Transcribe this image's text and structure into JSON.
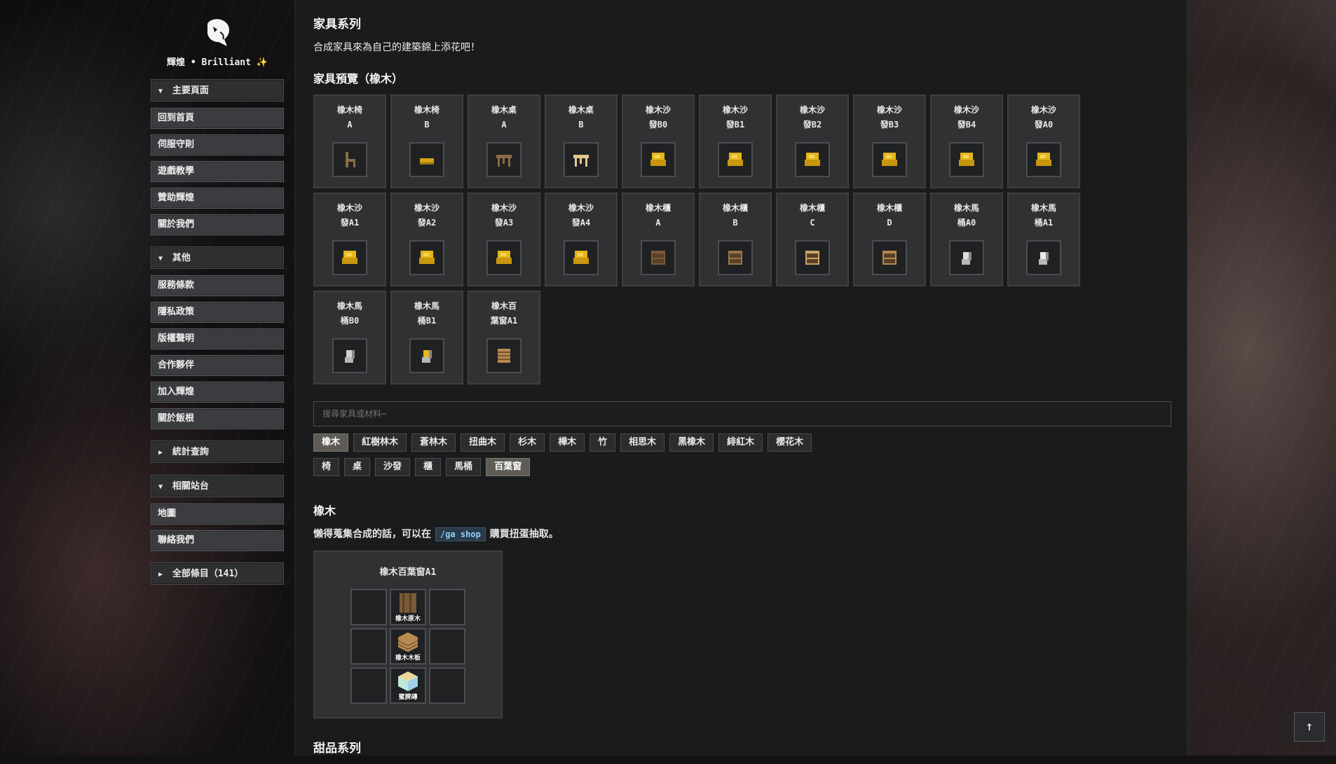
{
  "sidebar": {
    "brand": "輝煌 • Brilliant ✨",
    "main_section": {
      "label": "主要頁面",
      "items": [
        "回到首頁",
        "伺服守則",
        "遊戲教學",
        "贊助輝煌",
        "關於我們"
      ]
    },
    "other_section": {
      "label": "其他",
      "items": [
        "服務條款",
        "隱私政策",
        "版權聲明",
        "合作夥伴",
        "加入輝煌",
        "關於飯根"
      ]
    },
    "stats_section": {
      "label": "統計查詢"
    },
    "related_section": {
      "label": "相關站台",
      "items": [
        "地圖",
        "聯絡我們"
      ]
    },
    "all_section": {
      "label": "全部條目（141）"
    }
  },
  "main": {
    "title": "家具系列",
    "intro": "合成家具來為自己的建築錦上添花吧！",
    "preview_title": "家具預覽（橡木）",
    "cards": [
      {
        "name1": "橡木椅",
        "name2": "A",
        "icon": "chair",
        "color": "#8a6c45"
      },
      {
        "name1": "橡木椅",
        "name2": "B",
        "icon": "bench",
        "color": "#d4a418"
      },
      {
        "name1": "橡木桌",
        "name2": "A",
        "icon": "table",
        "color": "#8a6c45"
      },
      {
        "name1": "橡木桌",
        "name2": "B",
        "icon": "table",
        "color": "#e3c88a"
      },
      {
        "name1": "橡木沙",
        "name2": "發B0",
        "icon": "sofa",
        "color": "#e6b61a"
      },
      {
        "name1": "橡木沙",
        "name2": "發B1",
        "icon": "sofa",
        "color": "#e6b61a"
      },
      {
        "name1": "橡木沙",
        "name2": "發B2",
        "icon": "sofa",
        "color": "#e6b61a"
      },
      {
        "name1": "橡木沙",
        "name2": "發B3",
        "icon": "sofa",
        "color": "#e6b61a"
      },
      {
        "name1": "橡木沙",
        "name2": "發B4",
        "icon": "sofa",
        "color": "#e6b61a"
      },
      {
        "name1": "橡木沙",
        "name2": "發A0",
        "icon": "sofa",
        "color": "#e6b61a"
      },
      {
        "name1": "橡木沙",
        "name2": "發A1",
        "icon": "sofa",
        "color": "#e6b61a"
      },
      {
        "name1": "橡木沙",
        "name2": "發A2",
        "icon": "sofa",
        "color": "#e6b61a"
      },
      {
        "name1": "橡木沙",
        "name2": "發A3",
        "icon": "sofa",
        "color": "#e6b61a"
      },
      {
        "name1": "橡木沙",
        "name2": "發A4",
        "icon": "sofa",
        "color": "#e6b61a"
      },
      {
        "name1": "橡木櫃",
        "name2": "A",
        "icon": "cabinet",
        "color": "#7a5a38"
      },
      {
        "name1": "橡木櫃",
        "name2": "B",
        "icon": "cabinet",
        "color": "#9a7448"
      },
      {
        "name1": "橡木櫃",
        "name2": "C",
        "icon": "cabinet",
        "color": "#c9a566"
      },
      {
        "name1": "橡木櫃",
        "name2": "D",
        "icon": "cabinet",
        "color": "#b38a4e"
      },
      {
        "name1": "橡木馬",
        "name2": "桶A0",
        "icon": "toilet",
        "color": "#dcdcdc"
      },
      {
        "name1": "橡木馬",
        "name2": "桶A1",
        "icon": "toilet",
        "color": "#e8e8e8"
      },
      {
        "name1": "橡木馬",
        "name2": "桶B0",
        "icon": "toilet",
        "color": "#d0d0d0"
      },
      {
        "name1": "橡木馬",
        "name2": "桶B1",
        "icon": "toilet",
        "color": "#e6b61a"
      },
      {
        "name1": "橡木百",
        "name2": "葉窗A1",
        "icon": "blind",
        "color": "#b88a50"
      }
    ],
    "search_placeholder": "搜尋家具或材料⋯",
    "wood_filters": [
      "橡木",
      "紅樹林木",
      "蒼林木",
      "扭曲木",
      "杉木",
      "樺木",
      "竹",
      "相思木",
      "黑橡木",
      "緋紅木",
      "櫻花木"
    ],
    "wood_active": "橡木",
    "type_filters": [
      "椅",
      "桌",
      "沙發",
      "櫃",
      "馬桶",
      "百葉窗"
    ],
    "type_active": "百葉窗",
    "section_title": "橡木",
    "hint_before": "懶得蒐集合成的話，可以在",
    "hint_cmd": "/ga shop",
    "hint_after": "購買扭蛋抽取。",
    "recipe": {
      "title": "橡木百葉窗A1",
      "slots": [
        "",
        "橡木原木",
        "",
        "",
        "橡木木板",
        "",
        "",
        "蜜脾磚",
        ""
      ]
    },
    "next_section": "甜品系列"
  },
  "colors": {
    "active_chip": "#5e5c55",
    "panel": "#1a1b1d",
    "card": "#2f3133"
  },
  "icons": {
    "logo": "brand-logo-icon",
    "to_top": "arrow-up-icon"
  }
}
